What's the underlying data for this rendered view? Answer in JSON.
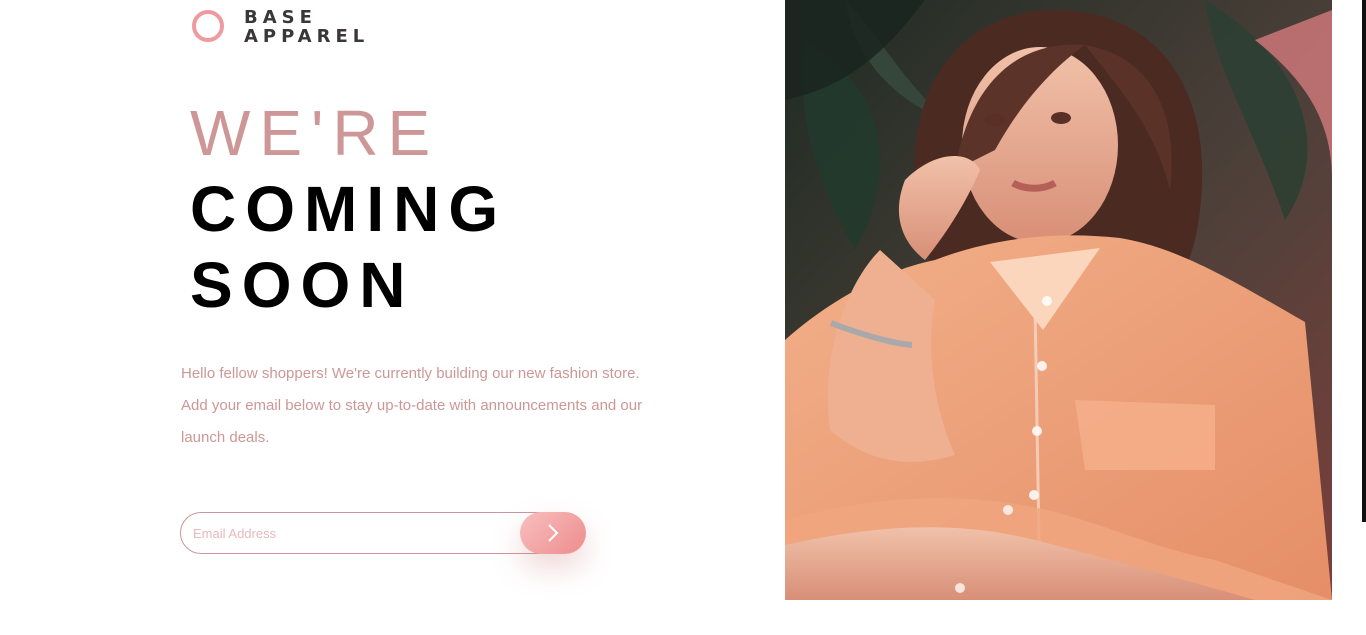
{
  "brand": {
    "line1": "BASE",
    "line2": "APPAREL",
    "accent_color": "#ef9a9e"
  },
  "hero": {
    "line1": "WE'RE",
    "line2": "COMING",
    "line3": "SOON",
    "light_color": "#ce9797",
    "dark_color": "#000000"
  },
  "description": {
    "text": "Hello fellow shoppers! We're currently building our new fashion store. Add your email below to stay up-to-date with announcements and our launch deals."
  },
  "signup": {
    "email_placeholder": "Email Address",
    "email_value": "",
    "submit_icon": "chevron-right-icon",
    "button_color": "#ee8c8c"
  },
  "image": {
    "subject": "woman in orange shirt",
    "alt": ""
  }
}
